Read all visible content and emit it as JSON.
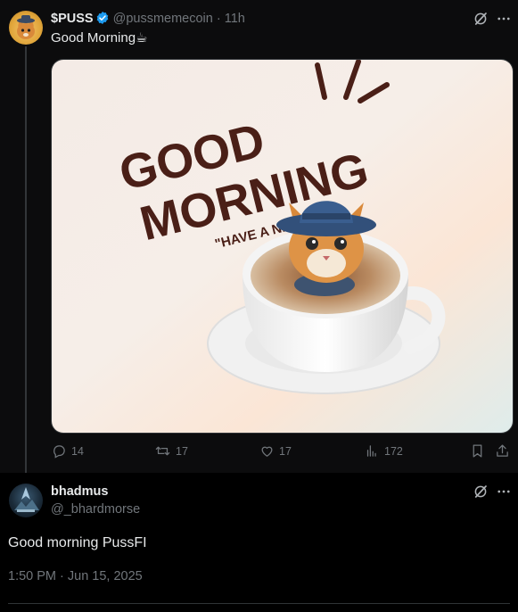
{
  "post": {
    "display_name": "$PUSS",
    "handle": "@pussmemecoin",
    "separator": "·",
    "age": "11h",
    "text": "Good Morning☕",
    "image_text": {
      "line1": "GOOD",
      "line2": "MORNING",
      "tagline": "\"HAVE A NICE DAY\""
    },
    "stats": {
      "replies": "14",
      "reposts": "17",
      "likes": "17",
      "views": "172"
    },
    "icons": [
      "grok-icon",
      "more-icon",
      "reply-icon",
      "repost-icon",
      "like-icon",
      "views-icon",
      "bookmark-icon",
      "share-icon"
    ],
    "colors": {
      "verified": "#1d9bf0",
      "muted": "#71767b",
      "lettering": "#4a1f17"
    }
  },
  "reply": {
    "display_name": "bhadmus",
    "handle": "@_bhardmorse",
    "text": "Good morning PussFI",
    "timestamp": "1:50 PM · Jun 15, 2025"
  }
}
